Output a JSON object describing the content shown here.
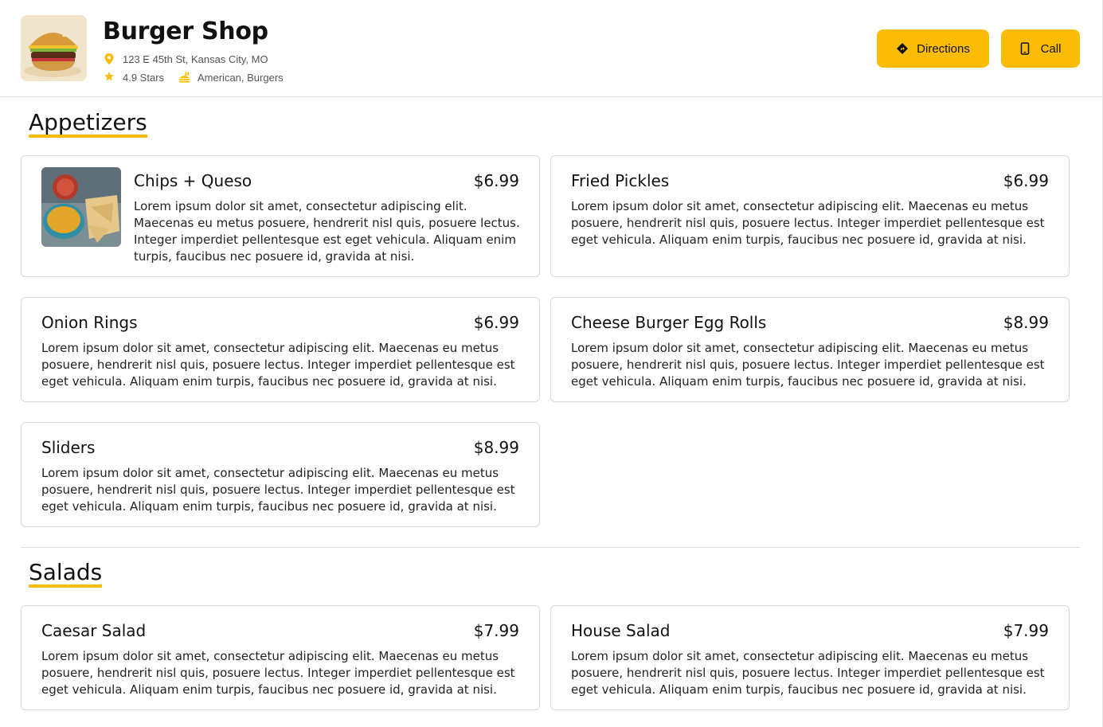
{
  "shop": {
    "name": "Burger Shop",
    "address": "123 E 45th St, Kansas City, MO",
    "rating": "4.9 Stars",
    "cuisine": "American, Burgers"
  },
  "actions": {
    "directions_label": "Directions",
    "call_label": "Call"
  },
  "colors": {
    "accent": "#fbbc05",
    "border": "#d8d8d8",
    "text": "#111111"
  },
  "icons": {
    "address": "map-pin-icon",
    "rating": "star-icon",
    "cuisine": "food-icon",
    "directions": "directions-icon",
    "call": "phone-icon"
  },
  "sections": [
    {
      "title": "Appetizers",
      "items": [
        {
          "name": "Chips + Queso",
          "price": "$6.99",
          "has_image": true,
          "description": "Lorem ipsum dolor sit amet, consectetur adipiscing elit. Maecenas eu metus posuere, hendrerit nisl quis, posuere lectus. Integer imperdiet pellentesque est eget vehicula. Aliquam enim turpis, faucibus nec posuere id, gravida at nisi."
        },
        {
          "name": "Fried Pickles",
          "price": "$6.99",
          "has_image": false,
          "description": "Lorem ipsum dolor sit amet, consectetur adipiscing elit. Maecenas eu metus posuere, hendrerit nisl quis, posuere lectus. Integer imperdiet pellentesque est eget vehicula. Aliquam enim turpis, faucibus nec posuere id, gravida at nisi."
        },
        {
          "name": "Onion Rings",
          "price": "$6.99",
          "has_image": false,
          "description": "Lorem ipsum dolor sit amet, consectetur adipiscing elit. Maecenas eu metus posuere, hendrerit nisl quis, posuere lectus. Integer imperdiet pellentesque est eget vehicula. Aliquam enim turpis, faucibus nec posuere id, gravida at nisi."
        },
        {
          "name": "Cheese Burger Egg Rolls",
          "price": "$8.99",
          "has_image": false,
          "description": "Lorem ipsum dolor sit amet, consectetur adipiscing elit. Maecenas eu metus posuere, hendrerit nisl quis, posuere lectus. Integer imperdiet pellentesque est eget vehicula. Aliquam enim turpis, faucibus nec posuere id, gravida at nisi."
        },
        {
          "name": "Sliders",
          "price": "$8.99",
          "has_image": false,
          "description": "Lorem ipsum dolor sit amet, consectetur adipiscing elit. Maecenas eu metus posuere, hendrerit nisl quis, posuere lectus. Integer imperdiet pellentesque est eget vehicula. Aliquam enim turpis, faucibus nec posuere id, gravida at nisi."
        }
      ]
    },
    {
      "title": "Salads",
      "items": [
        {
          "name": "Caesar Salad",
          "price": "$7.99",
          "has_image": false,
          "description": "Lorem ipsum dolor sit amet, consectetur adipiscing elit. Maecenas eu metus posuere, hendrerit nisl quis, posuere lectus. Integer imperdiet pellentesque est eget vehicula. Aliquam enim turpis, faucibus nec posuere id, gravida at nisi."
        },
        {
          "name": "House Salad",
          "price": "$7.99",
          "has_image": false,
          "description": "Lorem ipsum dolor sit amet, consectetur adipiscing elit. Maecenas eu metus posuere, hendrerit nisl quis, posuere lectus. Integer imperdiet pellentesque est eget vehicula. Aliquam enim turpis, faucibus nec posuere id, gravida at nisi."
        }
      ]
    }
  ]
}
